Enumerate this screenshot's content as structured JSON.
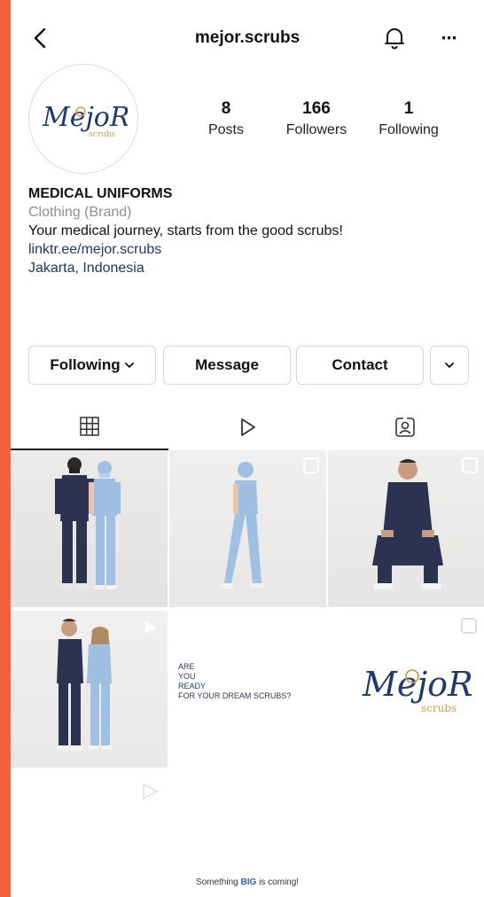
{
  "header": {
    "username": "mejor.scrubs"
  },
  "avatar": {
    "logo_text": "MejoR",
    "logo_sub": "scrubs"
  },
  "stats": {
    "posts": {
      "value": "8",
      "label": "Posts"
    },
    "followers": {
      "value": "166",
      "label": "Followers"
    },
    "following": {
      "value": "1",
      "label": "Following"
    }
  },
  "bio": {
    "name": "MEDICAL UNIFORMS",
    "category": "Clothing (Brand)",
    "description": "Your medical journey, starts from the good scrubs!",
    "link": "linktr.ee/mejor.scrubs",
    "location": "Jakarta, Indonesia"
  },
  "actions": {
    "following_label": "Following",
    "message_label": "Message",
    "contact_label": "Contact"
  },
  "posts": {
    "promo": {
      "line1": "ARE",
      "line2": "YOU",
      "line3": "READY",
      "line4": "FOR YOUR DREAM SCRUBS?",
      "logo_text": "MejoR",
      "logo_sub": "scrubs"
    },
    "teaser": {
      "prefix": "Something",
      "highlight": "BIG",
      "suffix": "is coming!"
    }
  },
  "colors": {
    "frame": "#f2603c",
    "logo_navy": "#1e3a6e",
    "logo_gold": "#c9a24a",
    "scrub_navy": "#2b3350",
    "scrub_blue": "#9fbfe3"
  },
  "icons": [
    "back-arrow-icon",
    "bell-icon",
    "more-dots-icon",
    "grid-icon",
    "reels-icon",
    "tagged-icon",
    "chevron-down-icon"
  ]
}
